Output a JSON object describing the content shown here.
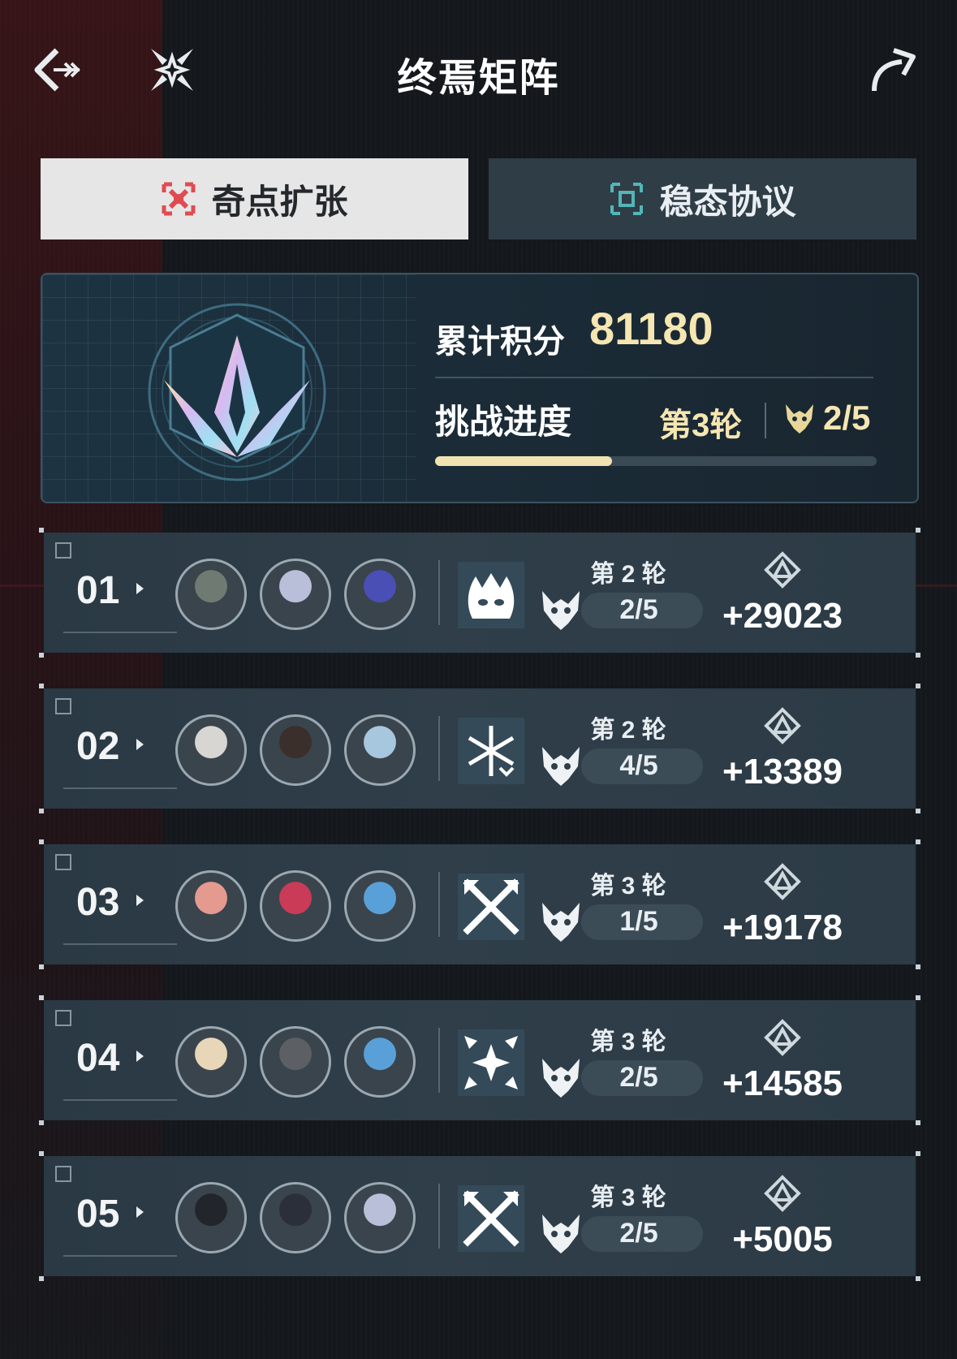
{
  "header": {
    "title": "终焉矩阵"
  },
  "tabs": [
    {
      "label": "奇点扩张",
      "active": true,
      "accent": "#e04b52"
    },
    {
      "label": "稳态协议",
      "active": false,
      "accent": "#53b6b6"
    }
  ],
  "summary": {
    "score_label": "累计积分",
    "score_value": "81180",
    "progress_label": "挑战进度",
    "round_label": "第3轮",
    "boss_count": "2/5",
    "progress_fraction": 0.4
  },
  "rows": [
    {
      "index": "01",
      "round": "第 2 轮",
      "boss": "2/5",
      "score": "+29023",
      "buff_icon": "flame-mask-icon",
      "avatars": [
        "#6f7a72",
        "#b9bfd8",
        "#4a4fb5"
      ]
    },
    {
      "index": "02",
      "round": "第 2 轮",
      "boss": "4/5",
      "score": "+13389",
      "buff_icon": "snowflake-icon",
      "avatars": [
        "#d8d6d2",
        "#3a2f2a",
        "#a7c7de"
      ]
    },
    {
      "index": "03",
      "round": "第 3 轮",
      "boss": "1/5",
      "score": "+19178",
      "buff_icon": "crossed-swords-icon",
      "avatars": [
        "#e59a90",
        "#c93b57",
        "#5aa0d8"
      ]
    },
    {
      "index": "04",
      "round": "第 3 轮",
      "boss": "2/5",
      "score": "+14585",
      "buff_icon": "star-burst-icon",
      "avatars": [
        "#e8d6b8",
        "#5c5f63",
        "#5aa0d8"
      ]
    },
    {
      "index": "05",
      "round": "第 3 轮",
      "boss": "2/5",
      "score": "+5005",
      "buff_icon": "crossed-swords-icon",
      "avatars": [
        "#22252b",
        "#2b2f3a",
        "#b9bfd8"
      ]
    }
  ],
  "colors": {
    "gold": "#f5e6b2",
    "row_bg": "#2f3e49"
  }
}
